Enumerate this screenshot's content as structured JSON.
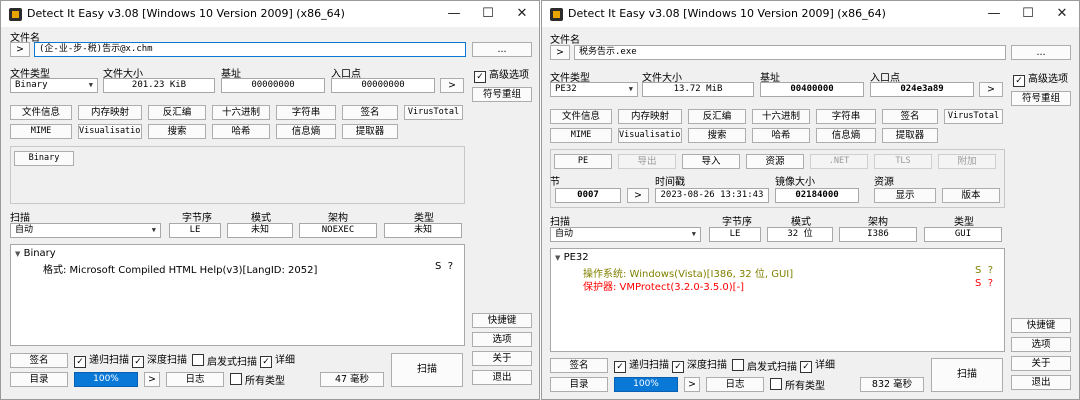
{
  "left_window": {
    "title": "Detect It Easy v3.08 [Windows 10 Version 2009] (x86_64)",
    "window_controls": {
      "minimize": "—",
      "maximize": "☐",
      "close": "✕"
    },
    "file_name_label": "文件名",
    "file_name_value": "(企-业-步-税)告示@x.chm",
    "browse_label": "...",
    "expand_label": ">",
    "file_type_label": "文件类型",
    "file_type_value": "Binary",
    "file_size_label": "文件大小",
    "file_size_value": "201.23 KiB",
    "base_label": "基址",
    "base_value": "00000000",
    "entry_label": "入口点",
    "entry_value": "00000000",
    "entry_btn": ">",
    "advanced_label": "高级选项",
    "sig_reorg_label": "符号重组",
    "buttons_row1": [
      "文件信息",
      "内存映射",
      "反汇编",
      "十六进制",
      "字符串",
      "签名",
      "VirusTotal"
    ],
    "buttons_row2": [
      "MIME",
      "Visualisation",
      "搜索",
      "哈希",
      "信息熵",
      "提取器"
    ],
    "binary_tab": "Binary",
    "scan_label": "扫描",
    "scan_mode_value": "自动",
    "endian_label": "字节序",
    "endian_value": "LE",
    "mode_label": "模式",
    "mode_value": "未知",
    "arch_label": "架构",
    "arch_value": "NOEXEC",
    "type_label": "类型",
    "type_value": "未知",
    "result_root": "Binary",
    "result_item": "格式: Microsoft Compiled HTML Help(v3)[LangID: 2052]",
    "result_flags": "S  ?",
    "shortcuts_label": "快捷键",
    "options_label": "选项",
    "about_label": "关于",
    "exit_label": "退出",
    "sign_label": "签名",
    "recursive_label": "递归扫描",
    "deep_label": "深度扫描",
    "heuristic_label": "启发式扫描",
    "verbose_label": "详细",
    "scan_button": "扫描",
    "dir_label": "目录",
    "progress_value": "100%",
    "progress_percent": 100,
    "next_label": ">",
    "log_label": "日志",
    "all_types_label": "所有类型",
    "time_label": "47 毫秒"
  },
  "right_window": {
    "title": "Detect It Easy v3.08 [Windows 10 Version 2009] (x86_64)",
    "window_controls": {
      "minimize": "—",
      "maximize": "☐",
      "close": "✕"
    },
    "file_name_label": "文件名",
    "file_name_value": "税务告示.exe",
    "browse_label": "...",
    "expand_label": ">",
    "file_type_label": "文件类型",
    "file_type_value": "PE32",
    "file_size_label": "文件大小",
    "file_size_value": "13.72 MiB",
    "base_label": "基址",
    "base_value": "00400000",
    "entry_label": "入口点",
    "entry_value": "024e3a89",
    "entry_btn": ">",
    "advanced_label": "高级选项",
    "sig_reorg_label": "符号重组",
    "buttons_row1": [
      "文件信息",
      "内存映射",
      "反汇编",
      "十六进制",
      "字符串",
      "签名",
      "VirusTotal"
    ],
    "buttons_row2": [
      "MIME",
      "Visualisation",
      "搜索",
      "哈希",
      "信息熵",
      "提取器"
    ],
    "pe_buttons": [
      "PE",
      "导出",
      "导入",
      "资源",
      ".NET",
      "TLS",
      "附加"
    ],
    "section_label": "节",
    "section_value": "0007",
    "section_btn": ">",
    "timestamp_label": "时间戳",
    "timestamp_value": "2023-08-26 13:31:43",
    "image_size_label": "镜像大小",
    "image_size_value": "02184000",
    "resource_label": "资源",
    "show_label": "显示",
    "version_label": "版本",
    "scan_label": "扫描",
    "scan_mode_value": "自动",
    "endian_label": "字节序",
    "endian_value": "LE",
    "mode_label": "模式",
    "mode_value": "32 位",
    "arch_label": "架构",
    "arch_value": "I386",
    "type_label": "类型",
    "type_value": "GUI",
    "result_root": "PE32",
    "result_os": "操作系统: Windows(Vista)[I386, 32 位, GUI]",
    "result_protector": "保护器: VMProtect(3.2.0-3.5.0)[-]",
    "result_flags": "S  ?",
    "color_os": "#808000",
    "color_protector": "#ff0000",
    "shortcuts_label": "快捷键",
    "options_label": "选项",
    "about_label": "关于",
    "exit_label": "退出",
    "sign_label": "签名",
    "recursive_label": "递归扫描",
    "deep_label": "深度扫描",
    "heuristic_label": "启发式扫描",
    "verbose_label": "详细",
    "scan_button": "扫描",
    "dir_label": "目录",
    "progress_value": "100%",
    "progress_percent": 100,
    "next_label": ">",
    "log_label": "日志",
    "all_types_label": "所有类型",
    "time_label": "832 毫秒"
  }
}
